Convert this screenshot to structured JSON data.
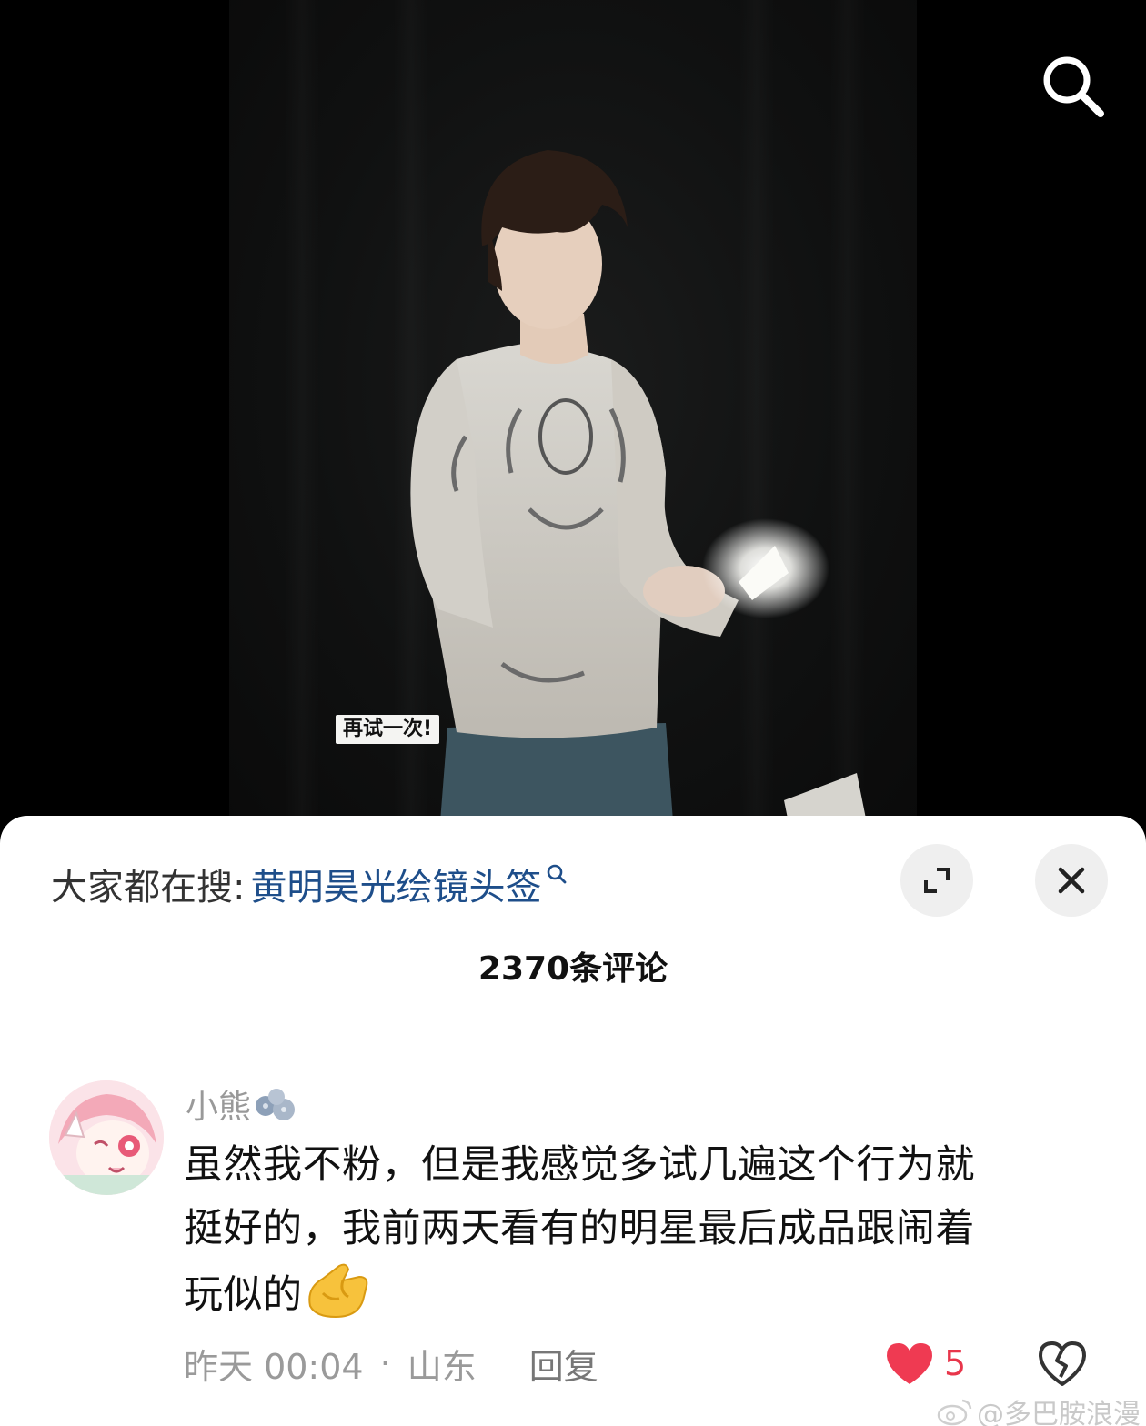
{
  "video": {
    "subtitle": "再试一次!"
  },
  "search_hint": {
    "prefix": "大家都在搜:",
    "keyword": "黄明昊光绘镜头签"
  },
  "comments_header": {
    "count_label": "2370条评论"
  },
  "comment": {
    "username": "小熊",
    "text_lines": [
      "虽然我不粉，但是我感觉多试几遍这个行为就",
      "挺好的，我前两天看有的明星最后成品跟闹着",
      "玩似的"
    ],
    "time": "昨天 00:04",
    "separator": "·",
    "location": "山东",
    "reply_label": "回复",
    "like_count": "5"
  },
  "watermark": {
    "text": "@多巴胺浪漫"
  },
  "colors": {
    "keyword_blue": "#1e4e8a",
    "like_red": "#e8364b",
    "meta_gray": "#9a9a9a"
  },
  "icons": [
    "search-icon",
    "expand-icon",
    "close-icon",
    "heart-icon",
    "broken-heart-icon",
    "blueberry-badge-icon",
    "ok-hand-emoji",
    "weibo-logo-icon"
  ]
}
